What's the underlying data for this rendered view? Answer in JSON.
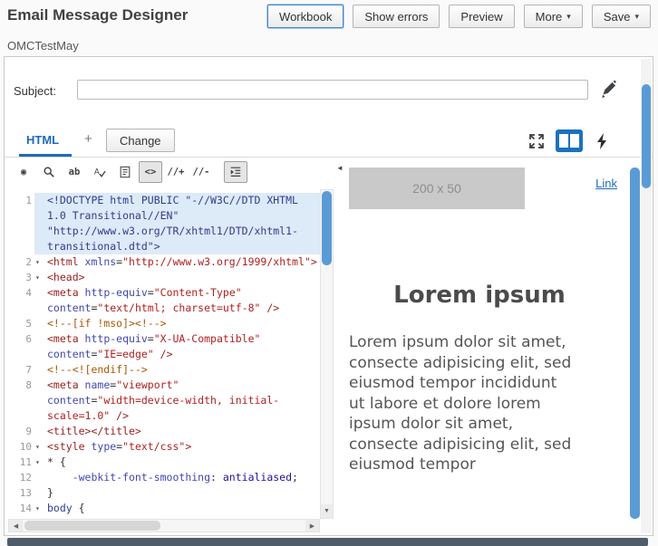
{
  "header": {
    "title": "Email Message Designer",
    "buttons": [
      {
        "name": "workbook-button",
        "label": "Workbook",
        "focused": true
      },
      {
        "name": "show-errors-button",
        "label": "Show errors"
      },
      {
        "name": "preview-button",
        "label": "Preview"
      },
      {
        "name": "more-button",
        "label": "More",
        "caret": true
      },
      {
        "name": "save-button",
        "label": "Save",
        "caret": true
      }
    ]
  },
  "breadcrumb": "OMCTestMay",
  "subject": {
    "label": "Subject:",
    "value": ""
  },
  "tabs": {
    "active_label": "HTML",
    "add_label": "+",
    "change_label": "Change"
  },
  "view_icons": [
    {
      "name": "maximize-icon",
      "svg": "expand"
    },
    {
      "name": "split-view-icon",
      "svg": "split",
      "active": true
    },
    {
      "name": "dynamic-content-icon",
      "svg": "bolt"
    }
  ],
  "editor": {
    "toolbar": [
      {
        "name": "tag-inspector-icon",
        "glyph": "◉"
      },
      {
        "name": "search-icon",
        "svg": "search"
      },
      {
        "name": "find-replace-icon",
        "glyph": "ab"
      },
      {
        "name": "spell-check-icon",
        "svg": "spell"
      },
      {
        "name": "validate-html-icon",
        "svg": "doc"
      },
      {
        "name": "code-view-icon",
        "glyph": "<>",
        "active": true
      },
      {
        "name": "add-comment-icon",
        "glyph": "//+"
      },
      {
        "name": "remove-comment-icon",
        "glyph": "//-"
      },
      {
        "name": "auto-indent-icon",
        "svg": "indent",
        "active": true,
        "gap": true
      }
    ],
    "rows": [
      {
        "n": "1",
        "h": true,
        "s": [
          [
            "meta",
            "<!DOCTYPE html PUBLIC \"-//W3C//DTD XHTML"
          ]
        ]
      },
      {
        "n": "",
        "h": true,
        "s": [
          [
            "meta",
            "1.0 Transitional//EN\""
          ]
        ]
      },
      {
        "n": "",
        "h": true,
        "s": [
          [
            "meta",
            "\"http://www.w3.org/TR/xhtml1/DTD/xhtml1-"
          ]
        ]
      },
      {
        "n": "",
        "h": true,
        "s": [
          [
            "meta",
            "transitional.dtd\">"
          ]
        ]
      },
      {
        "n": "2",
        "f": true,
        "s": [
          [
            "tag",
            "<html "
          ],
          [
            "attr",
            "xmlns"
          ],
          [
            "plain",
            "="
          ],
          [
            "str",
            "\"http://www.w3.org/1999/xhtml\""
          ],
          [
            "tag",
            ">"
          ]
        ]
      },
      {
        "n": "3",
        "f": true,
        "s": [
          [
            "tag",
            "<head>"
          ]
        ]
      },
      {
        "n": "4",
        "s": [
          [
            "tag",
            "<meta "
          ],
          [
            "attr",
            "http-equiv"
          ],
          [
            "plain",
            "="
          ],
          [
            "str",
            "\"Content-Type\""
          ]
        ]
      },
      {
        "n": "",
        "s": [
          [
            "attr",
            "content"
          ],
          [
            "plain",
            "="
          ],
          [
            "str",
            "\"text/html; charset=utf-8\""
          ],
          [
            "tag",
            " />"
          ]
        ]
      },
      {
        "n": "5",
        "s": [
          [
            "comment",
            "<!--[if !mso]><!-->"
          ]
        ]
      },
      {
        "n": "6",
        "s": [
          [
            "tag",
            "<meta "
          ],
          [
            "attr",
            "http-equiv"
          ],
          [
            "plain",
            "="
          ],
          [
            "str",
            "\"X-UA-Compatible\""
          ]
        ]
      },
      {
        "n": "",
        "s": [
          [
            "attr",
            "content"
          ],
          [
            "plain",
            "="
          ],
          [
            "str",
            "\"IE=edge\""
          ],
          [
            "tag",
            " />"
          ]
        ]
      },
      {
        "n": "7",
        "s": [
          [
            "comment",
            "<!--<![endif]-->"
          ]
        ]
      },
      {
        "n": "8",
        "s": [
          [
            "tag",
            "<meta "
          ],
          [
            "attr",
            "name"
          ],
          [
            "plain",
            "="
          ],
          [
            "str",
            "\"viewport\""
          ]
        ]
      },
      {
        "n": "",
        "s": [
          [
            "attr",
            "content"
          ],
          [
            "plain",
            "="
          ],
          [
            "str",
            "\"width=device-width, initial-"
          ]
        ]
      },
      {
        "n": "",
        "s": [
          [
            "str",
            "scale=1.0\" "
          ],
          [
            "tag",
            "/>"
          ]
        ]
      },
      {
        "n": "9",
        "s": [
          [
            "tag",
            "<title></title>"
          ]
        ]
      },
      {
        "n": "10",
        "f": true,
        "s": [
          [
            "tag",
            "<style "
          ],
          [
            "attr",
            "type"
          ],
          [
            "plain",
            "="
          ],
          [
            "str",
            "\"text/css\""
          ],
          [
            "tag",
            ">"
          ]
        ]
      },
      {
        "n": "11",
        "f": true,
        "s": [
          [
            "plain",
            "* {"
          ]
        ]
      },
      {
        "n": "12",
        "s": [
          [
            "prop",
            "    -webkit-font-smoothing"
          ],
          [
            "plain",
            ": "
          ],
          [
            "atom",
            "antialiased"
          ],
          [
            "plain",
            ";"
          ]
        ]
      },
      {
        "n": "13",
        "s": [
          [
            "plain",
            "}"
          ]
        ]
      },
      {
        "n": "14",
        "f": true,
        "s": [
          [
            "meta",
            "body"
          ],
          [
            "plain",
            " {"
          ]
        ]
      }
    ]
  },
  "preview": {
    "placeholder_label": "200 x 50",
    "link_label": "Link",
    "heading": "Lorem ipsum",
    "body": "Lorem ipsum dolor sit amet, consecte adipisicing elit, sed eiusmod tempor incididunt ut labore et dolore lorem ipsum dolor sit amet, consecte adipisicing elit, sed eiusmod tempor"
  },
  "glyphs": {
    "caret_down": "▾",
    "fold_open": "▾",
    "scroll_down": "▼",
    "scroll_left": "◀",
    "scroll_right": "▶",
    "collapse_left": "◄"
  },
  "colors": {
    "accent_blue": "#1b72c0",
    "scrollbar_blue": "#5b9bd5",
    "active_line_highlight": "#ddeaf8"
  }
}
